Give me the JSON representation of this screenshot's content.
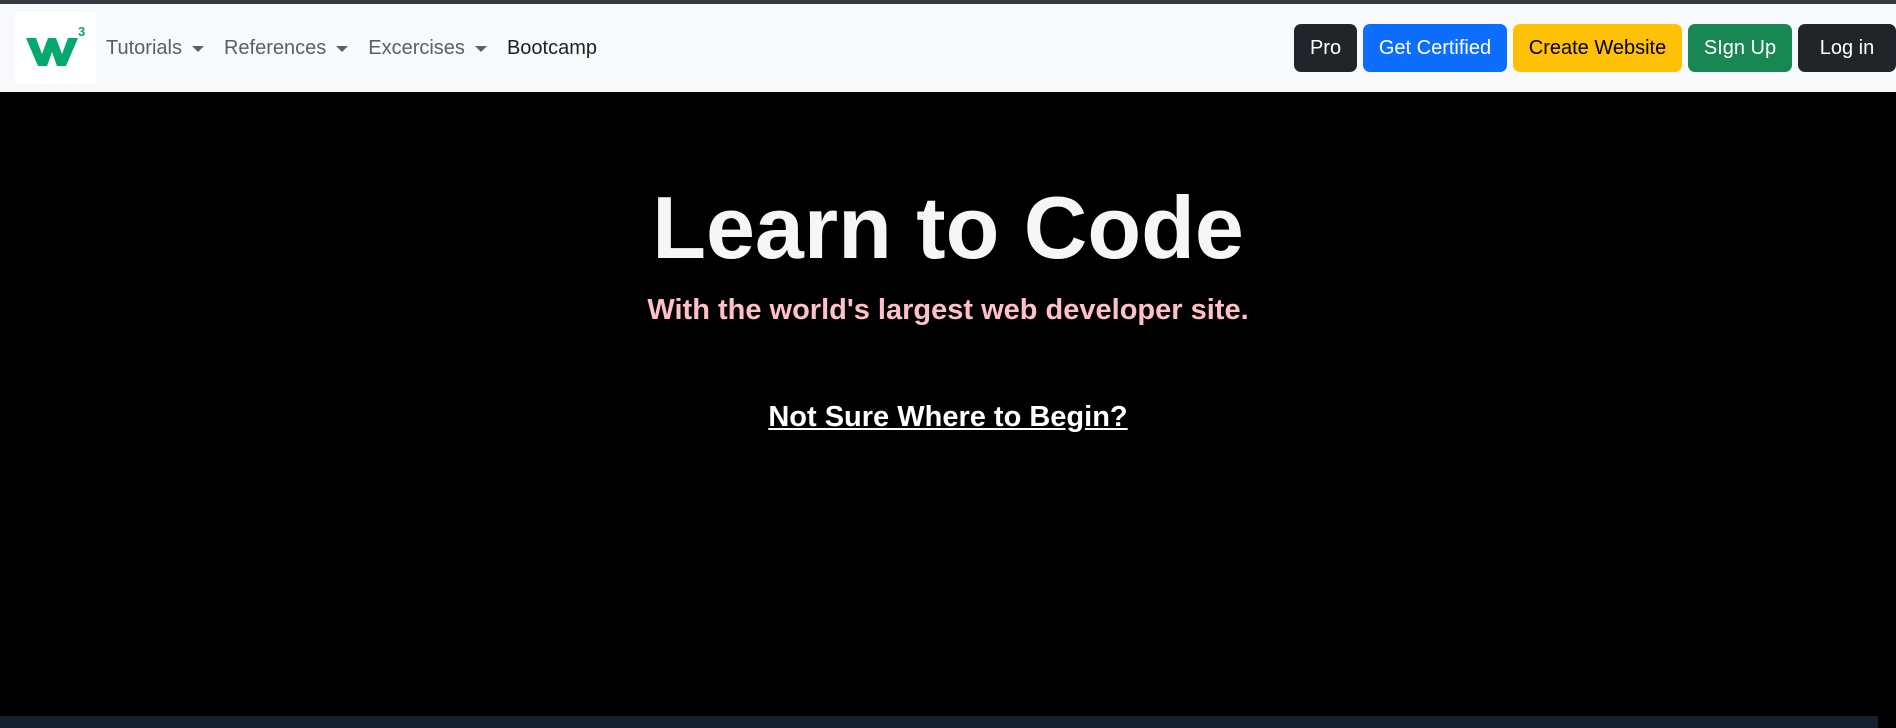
{
  "nav": {
    "items": [
      {
        "label": "Tutorials",
        "dropdown": true
      },
      {
        "label": "References",
        "dropdown": true
      },
      {
        "label": "Excercises",
        "dropdown": true
      },
      {
        "label": "Bootcamp",
        "dropdown": false
      }
    ],
    "buttons": {
      "pro": "Pro",
      "get_certified": "Get Certified",
      "create_website": "Create Website",
      "sign_up": "SIgn Up",
      "log_in": "Log in"
    }
  },
  "hero": {
    "title": "Learn to Code",
    "subtitle": "With the world's largest web developer site.",
    "link": "Not Sure Where to Begin?"
  },
  "colors": {
    "brand_green": "#04aa6d",
    "subtitle_pink": "#ffc0c7",
    "primary_blue": "#0d6efd",
    "warning_yellow": "#ffc107",
    "success_green": "#198754",
    "dark": "#212529"
  }
}
